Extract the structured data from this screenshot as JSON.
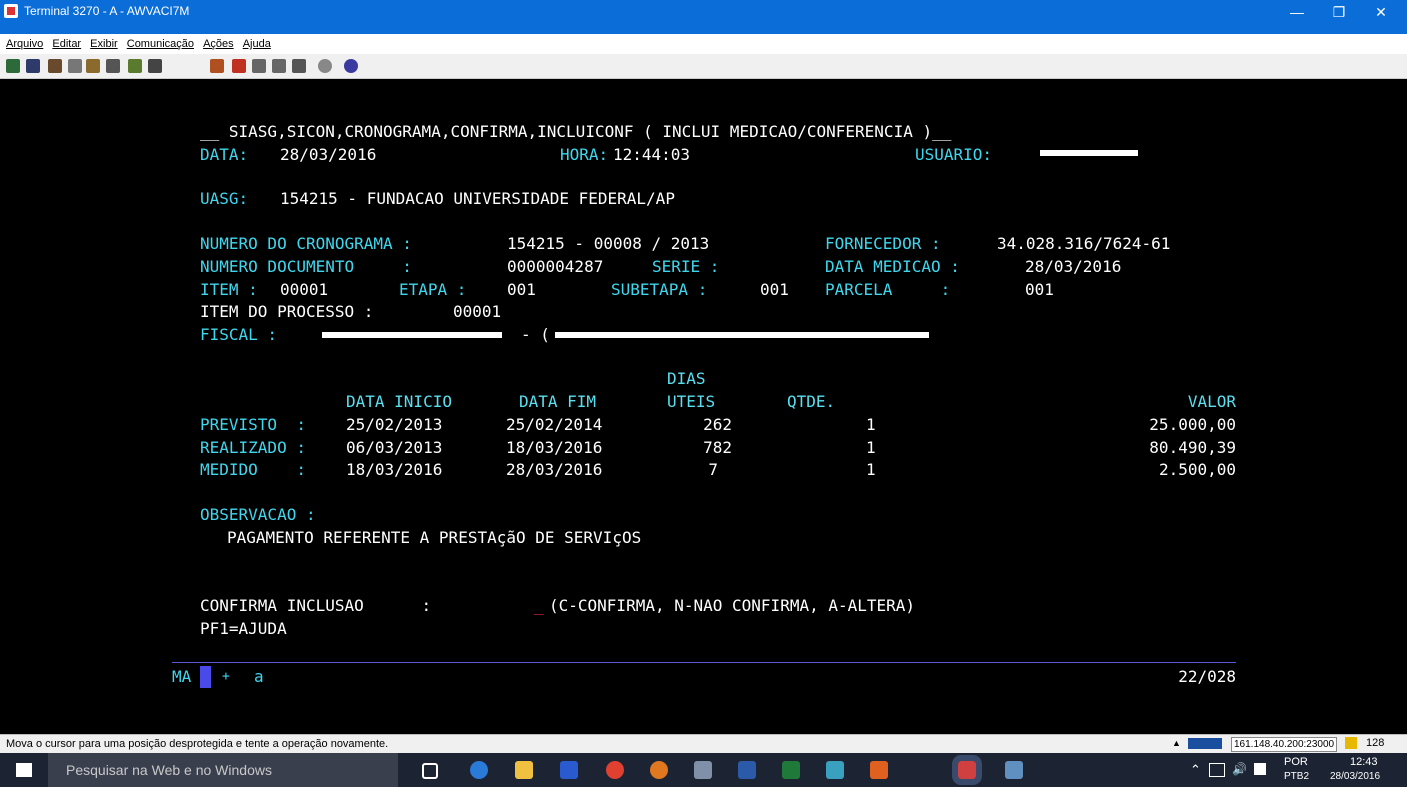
{
  "window": {
    "title": "Terminal 3270 - A - AWVACI7M"
  },
  "menu": [
    "Arquivo",
    "Editar",
    "Exibir",
    "Comunicação",
    "Ações",
    "Ajuda"
  ],
  "terminal": {
    "header": "__ SIASG,SICON,CRONOGRAMA,CONFIRMA,INCLUICONF ( INCLUI MEDICAO/CONFERENCIA )__",
    "data_label": "DATA:",
    "data_value": "28/03/2016",
    "hora_label": "HORA:",
    "hora_value": "12:44:03",
    "usuario_label": "USUARIO:",
    "uasg_label": "UASG:",
    "uasg_value": "154215 - FUNDACAO UNIVERSIDADE FEDERAL/AP",
    "cronograma_label": "NUMERO DO CRONOGRAMA :",
    "cronograma_value": "154215 - 00008 / 2013",
    "fornecedor_label": "FORNECEDOR :",
    "fornecedor_value": "34.028.316/7624-61",
    "documento_label": "NUMERO DOCUMENTO     :",
    "documento_value": "0000004287",
    "serie_label": "SERIE :",
    "data_medicao_label": "DATA MEDICAO :",
    "data_medicao_value": "28/03/2016",
    "item_label": "ITEM :",
    "item_value": "00001",
    "etapa_label": "ETAPA :",
    "etapa_value": "001",
    "subetapa_label": "SUBETAPA :",
    "subetapa_value": "001",
    "parcela_label": "PARCELA     :",
    "parcela_value": "001",
    "item_processo_label": "ITEM DO PROCESSO :",
    "item_processo_value": "00001",
    "fiscal_label": "FISCAL :",
    "fiscal_sep": "- (",
    "table": {
      "col_dias": "DIAS",
      "col_data_inicio": "DATA INICIO",
      "col_data_fim": "DATA FIM",
      "col_uteis": "UTEIS",
      "col_qtde": "QTDE.",
      "col_valor": "VALOR",
      "rows": [
        {
          "label": "PREVISTO  :",
          "inicio": "25/02/2013",
          "fim": "25/02/2014",
          "dias": "262",
          "qtde": "1",
          "valor": "25.000,00"
        },
        {
          "label": "REALIZADO :",
          "inicio": "06/03/2013",
          "fim": "18/03/2016",
          "dias": "782",
          "qtde": "1",
          "valor": "80.490,39"
        },
        {
          "label": "MEDIDO    :",
          "inicio": "18/03/2016",
          "fim": "28/03/2016",
          "dias": "7",
          "qtde": "1",
          "valor": "2.500,00"
        }
      ]
    },
    "observacao_label": "OBSERVACAO :",
    "observacao_text": "PAGAMENTO REFERENTE A PRESTAçãO DE SERVIçOS",
    "confirma_label": "CONFIRMA INCLUSAO      :",
    "confirma_value": "_",
    "confirma_options": "(C-CONFIRMA, N-NAO CONFIRMA, A-ALTERA)",
    "pf1": "PF1=AJUDA"
  },
  "oia": {
    "left1": "MA",
    "left2": "+",
    "left3": "a",
    "cursor_pos": "22/028"
  },
  "status": {
    "message": "Mova o cursor para uma posição desprotegida e tente a operação novamente.",
    "host": "161.148.40.200:23000",
    "sessions": "128"
  },
  "taskbar": {
    "search_placeholder": "Pesquisar na Web e no Windows",
    "lang1": "POR",
    "lang2": "PTB2",
    "time": "12:43",
    "date": "28/03/2016"
  }
}
